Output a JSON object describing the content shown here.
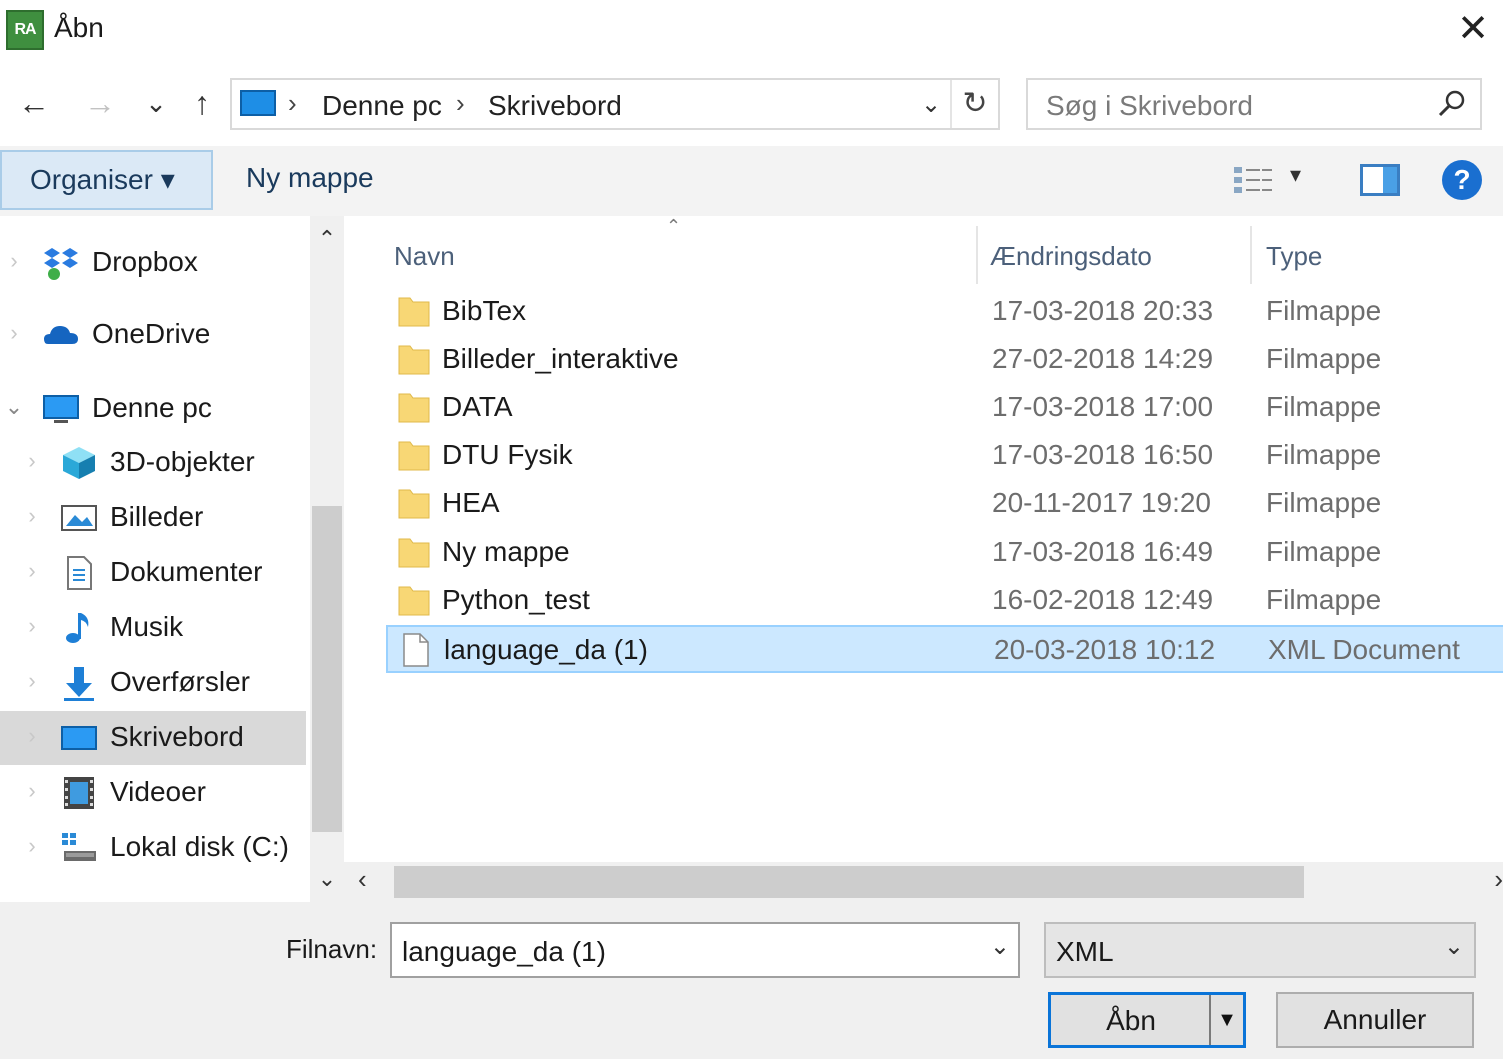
{
  "window": {
    "title": "Åbn",
    "app_icon_text": "RA",
    "close_glyph": "✕"
  },
  "navigation": {
    "back": "←",
    "forward": "→",
    "recent": "⌄",
    "up": "↑"
  },
  "address": {
    "crumbs": [
      "Denne pc",
      "Skrivebord"
    ],
    "separator": "›",
    "dropdown": "⌄",
    "refresh": "↻"
  },
  "search": {
    "placeholder": "Søg i Skrivebord"
  },
  "toolbar": {
    "organise_label": "Organiser ▾",
    "new_folder_label": "Ny mappe",
    "view_dropdown": "▾",
    "help": "?"
  },
  "sidebar": {
    "items": [
      {
        "label": "Dropbox",
        "icon": "dropbox-icon"
      },
      {
        "label": "OneDrive",
        "icon": "onedrive-icon"
      },
      {
        "label": "Denne pc",
        "icon": "this-pc-icon",
        "expanded": true
      },
      {
        "label": "3D-objekter",
        "icon": "3d-objects-icon"
      },
      {
        "label": "Billeder",
        "icon": "pictures-icon"
      },
      {
        "label": "Dokumenter",
        "icon": "documents-icon"
      },
      {
        "label": "Musik",
        "icon": "music-icon"
      },
      {
        "label": "Overførsler",
        "icon": "downloads-icon"
      },
      {
        "label": "Skrivebord",
        "icon": "desktop-icon",
        "selected": true
      },
      {
        "label": "Videoer",
        "icon": "videos-icon"
      },
      {
        "label": "Lokal disk (C:)",
        "icon": "local-disk-icon"
      }
    ]
  },
  "columns": {
    "name": "Navn",
    "date": "Ændringsdato",
    "type": "Type"
  },
  "files": [
    {
      "name": "BibTex",
      "date": "17-03-2018 20:33",
      "type": "Filmappe",
      "icon": "folder-icon"
    },
    {
      "name": "Billeder_interaktive",
      "date": "27-02-2018 14:29",
      "type": "Filmappe",
      "icon": "folder-icon"
    },
    {
      "name": "DATA",
      "date": "17-03-2018 17:00",
      "type": "Filmappe",
      "icon": "folder-icon"
    },
    {
      "name": "DTU Fysik",
      "date": "17-03-2018 16:50",
      "type": "Filmappe",
      "icon": "folder-icon"
    },
    {
      "name": "HEA",
      "date": "20-11-2017 19:20",
      "type": "Filmappe",
      "icon": "folder-icon"
    },
    {
      "name": "Ny mappe",
      "date": "17-03-2018 16:49",
      "type": "Filmappe",
      "icon": "folder-icon"
    },
    {
      "name": "Python_test",
      "date": "16-02-2018 12:49",
      "type": "Filmappe",
      "icon": "folder-icon"
    },
    {
      "name": "language_da (1)",
      "date": "20-03-2018 10:12",
      "type": "XML Document",
      "icon": "document-icon",
      "selected": true
    }
  ],
  "footer": {
    "filename_label": "Filnavn:",
    "filename_value": "language_da (1)",
    "filetype_value": "XML",
    "open_label": "Åbn",
    "cancel_label": "Annuller"
  },
  "colors": {
    "accent": "#0a74d8",
    "selection": "#cce8ff",
    "folder": "#f8d775"
  }
}
